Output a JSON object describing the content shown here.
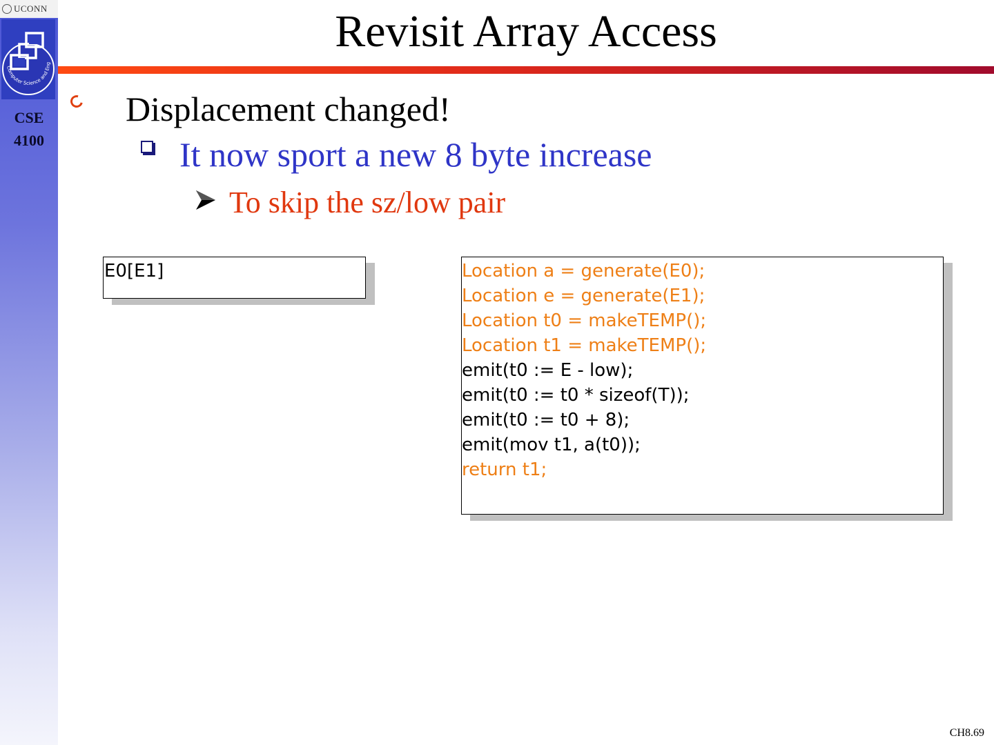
{
  "sidebar": {
    "university": "UCONN",
    "course_line1": "CSE",
    "course_line2": "4100",
    "logo_ring_text": "Computer Science and Engineering"
  },
  "slide": {
    "title": "Revisit Array Access",
    "bullets": [
      {
        "level": 1,
        "icon": "circle-bullet-icon",
        "text": "Displacement changed!"
      },
      {
        "level": 2,
        "icon": "square-bullet-icon",
        "text": "It now sport a new 8 byte increase"
      },
      {
        "level": 3,
        "icon": "arrow-bullet-icon",
        "text": "To skip the sz/low pair"
      }
    ],
    "expression": "E0[E1]",
    "code": [
      {
        "text": "Location a = generate(E0);",
        "style": "orange"
      },
      {
        "text": "Location e = generate(E1);",
        "style": "orange"
      },
      {
        "text": "Location t0 = makeTEMP();",
        "style": "orange"
      },
      {
        "text": "Location t1 = makeTEMP();",
        "style": "orange"
      },
      {
        "text": "emit(t0 := E - low);",
        "style": "black"
      },
      {
        "text": "emit(t0 := t0 * sizeof(T));",
        "style": "black"
      },
      {
        "text": "emit(t0 := t0 + 8);",
        "style": "black"
      },
      {
        "text": "emit(mov t1, a(t0));",
        "style": "black"
      },
      {
        "text": "return t1;",
        "style": "orange"
      }
    ],
    "footer": "CH8.69"
  },
  "colors": {
    "title_rule_start": "#ff4a12",
    "title_rule_end": "#a10b2c",
    "level2_text": "#2f35c7",
    "level3_text": "#e0380f",
    "code_highlight": "#ee7f16"
  }
}
